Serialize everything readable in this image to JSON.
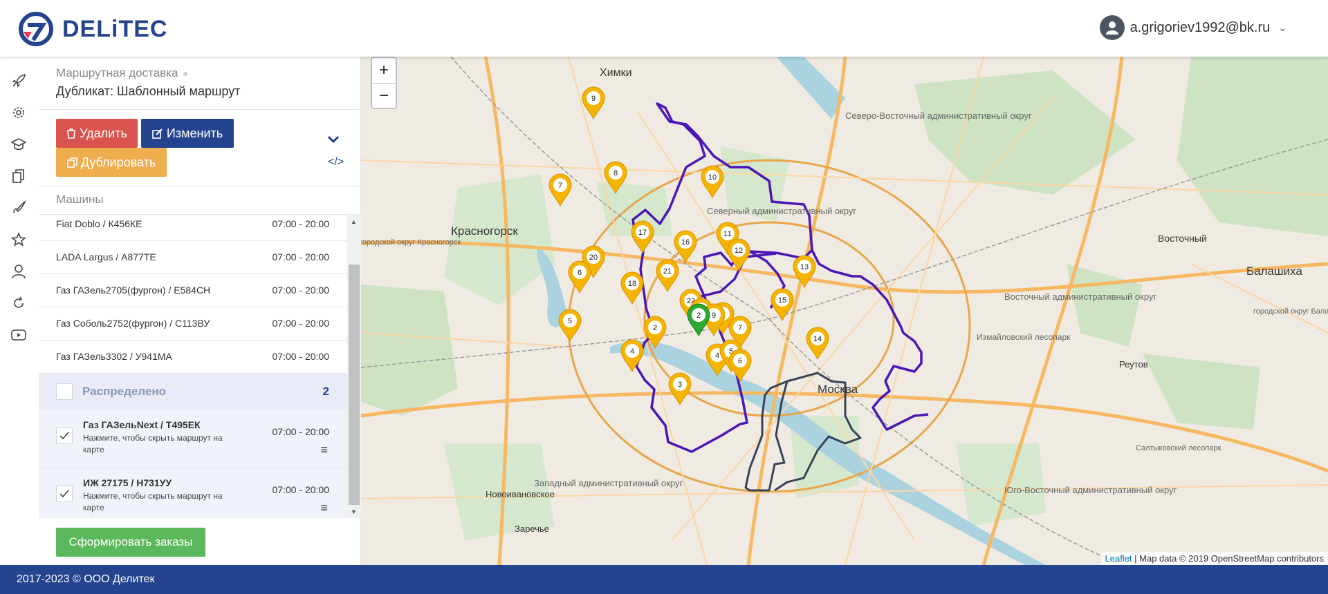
{
  "header": {
    "brand": "DELiTEC",
    "user_email": "a.grigoriev1992@bk.ru"
  },
  "rail_icons": [
    "rocket-icon",
    "gear-icon",
    "graduation-cap-icon",
    "documents-icon",
    "rocket-launch-icon",
    "star-icon",
    "user-support-icon",
    "refresh-icon",
    "youtube-icon"
  ],
  "panel": {
    "breadcrumb": "Маршрутная доставка",
    "subtitle": "Дубликат: Шаблонный маршрут",
    "buttons": {
      "delete": "Удалить",
      "edit": "Изменить",
      "duplicate": "Дублировать",
      "form_orders": "Сформировать заказы"
    },
    "machines_label": "Машины",
    "vehicles": [
      {
        "name": "Fiat Doblo / К456КЕ",
        "time": "07:00 - 20:00"
      },
      {
        "name": "LADA Largus / А877ТЕ",
        "time": "07:00 - 20:00"
      },
      {
        "name": "Газ ГАЗель2705(фургон) / Е584СН",
        "time": "07:00 - 20:00"
      },
      {
        "name": "Газ Соболь2752(фургон) / С113ВУ",
        "time": "07:00 - 20:00"
      },
      {
        "name": "Газ ГАЗель3302 / У941МА",
        "time": "07:00 - 20:00"
      }
    ],
    "group": {
      "label": "Распределено",
      "count": "2"
    },
    "assigned": [
      {
        "name": "Газ ГАЗельNext / Т495ЕК",
        "note": "Нажмите, чтобы скрыть маршрут на карте",
        "time": "07:00 - 20:00"
      },
      {
        "name": "ИЖ 27175 / Н731УУ",
        "note": "Нажмите, чтобы скрыть маршрут на карте",
        "time": "07:00 - 20:00"
      }
    ]
  },
  "map": {
    "zoom_in": "+",
    "zoom_out": "−",
    "attribution_link": "Leaflet",
    "attribution_text": " | Map data © 2019 OpenStreetMap contributors",
    "labels": [
      "Химки",
      "Красногорск",
      "Северо-Восточный административный округ",
      "Северный административный округ",
      "Восточный",
      "Балашиха",
      "Восточный административный округ",
      "Измайловский лесопарк",
      "Реутов",
      "городской округ Балашиха",
      "Москва",
      "Западный административный округ",
      "Юго-Восточный административный округ",
      "Новоивановское",
      "Заречье",
      "Салтыковский лесопарк",
      "городской округ Красногорск"
    ],
    "markers_orange": [
      "9",
      "8",
      "7",
      "10",
      "11",
      "12",
      "16",
      "17",
      "20",
      "6",
      "21",
      "13",
      "18",
      "15",
      "22",
      "1",
      "8",
      "9",
      "5",
      "2",
      "7",
      "14",
      "4",
      "4",
      "5",
      "6",
      "3"
    ],
    "marker_green": "2"
  },
  "footer": {
    "text": "2017-2023 © ООО Делитек"
  },
  "colors": {
    "brand": "#25448f",
    "route_purple": "#4b17b5",
    "route_dark": "#3a4257",
    "marker_orange": "#f4b400",
    "marker_green": "#2ea82e"
  }
}
